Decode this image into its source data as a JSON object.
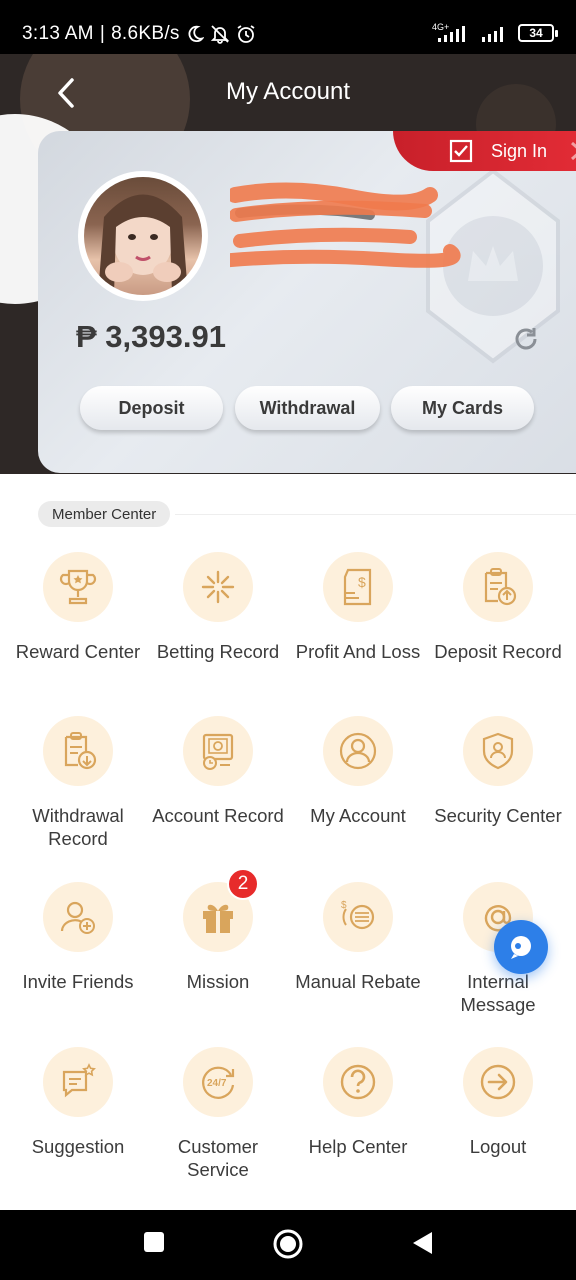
{
  "status_bar": {
    "time": "3:13 AM",
    "speed": "8.6KB/s",
    "network": "4G+",
    "battery": "34"
  },
  "header": {
    "title": "My Account",
    "sign_in_label": "Sign In"
  },
  "profile": {
    "balance": "₱ 3,393.91",
    "buttons": {
      "deposit": "Deposit",
      "withdrawal": "Withdrawal",
      "cards": "My Cards"
    }
  },
  "member_center": {
    "title": "Member Center",
    "items": [
      {
        "label": "Reward Center",
        "icon": "trophy-icon"
      },
      {
        "label": "Betting Record",
        "icon": "sparkle-icon"
      },
      {
        "label": "Profit And Loss",
        "icon": "dollar-document-icon"
      },
      {
        "label": "Deposit Record",
        "icon": "clipboard-up-icon"
      },
      {
        "label": "Withdrawal Record",
        "icon": "clipboard-down-icon"
      },
      {
        "label": "Account Record",
        "icon": "account-record-icon"
      },
      {
        "label": "My Account",
        "icon": "user-icon"
      },
      {
        "label": "Security Center",
        "icon": "shield-icon"
      },
      {
        "label": "Invite Friends",
        "icon": "add-user-icon"
      },
      {
        "label": "Mission",
        "icon": "gift-icon",
        "badge": "2"
      },
      {
        "label": "Manual Rebate",
        "icon": "coins-icon"
      },
      {
        "label": "Internal Message",
        "icon": "at-icon"
      },
      {
        "label": "Suggestion",
        "icon": "chat-star-icon"
      },
      {
        "label": "Customer Service",
        "icon": "support-24-7-icon"
      },
      {
        "label": "Help Center",
        "icon": "question-icon"
      },
      {
        "label": "Logout",
        "icon": "logout-icon"
      }
    ]
  },
  "colors": {
    "accent_red": "#e32c36",
    "icon_gold": "#d9a55c",
    "icon_bg": "#fdf0dc",
    "chat_blue": "#2d7fe8"
  }
}
